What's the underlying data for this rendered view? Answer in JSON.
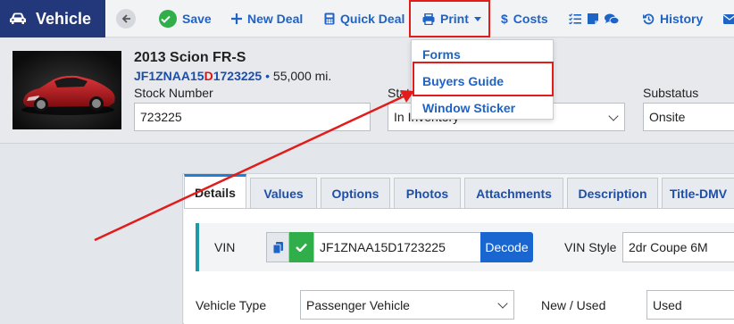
{
  "brand": {
    "title": "Vehicle"
  },
  "toolbar": {
    "save": "Save",
    "new_deal": "New Deal",
    "quick_deal": "Quick Deal",
    "print": "Print",
    "costs": "Costs",
    "history": "History"
  },
  "print_menu": {
    "items": [
      "Forms",
      "Buyers Guide",
      "Window Sticker"
    ]
  },
  "vehicle": {
    "title": "2013 Scion FR-S",
    "vin_prefix": "JF1ZNAA15",
    "vin_mark": "D",
    "vin_suffix": "1723225",
    "separator": "•",
    "mileage": "55,000 mi."
  },
  "stock": {
    "label": "Stock Number",
    "value": "723225"
  },
  "status": {
    "label": "Status",
    "value": "In Inventory"
  },
  "substatus": {
    "label": "Substatus",
    "value": "Onsite"
  },
  "tabs": [
    "Details",
    "Values",
    "Options",
    "Photos",
    "Attachments",
    "Description",
    "Title-DMV"
  ],
  "details": {
    "vin_label": "VIN",
    "vin_value": "JF1ZNAA15D1723225",
    "decode": "Decode",
    "vin_style_label": "VIN Style",
    "vin_style_value": "2dr Coupe 6M",
    "vehicle_type_label": "Vehicle Type",
    "vehicle_type_value": "Passenger Vehicle",
    "new_used_label": "New / Used",
    "new_used_value": "Used"
  },
  "colors": {
    "brand": "#23387a",
    "link": "#1e63c6",
    "highlight": "#e21b1b",
    "success": "#2fae4a"
  }
}
